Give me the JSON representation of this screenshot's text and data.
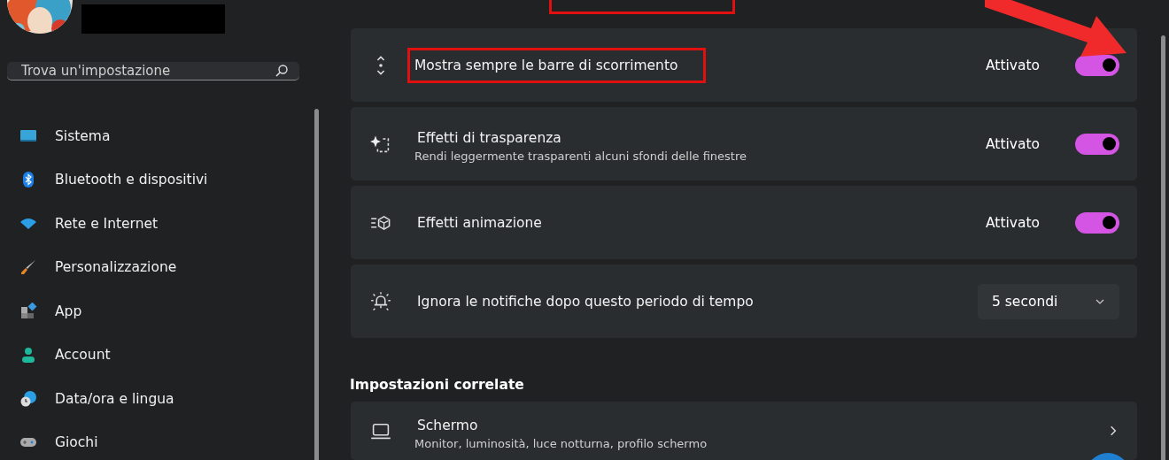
{
  "sidebar": {
    "search": {
      "placeholder": "Trova un'impostazione"
    },
    "items": [
      {
        "label": "Sistema",
        "selected": false
      },
      {
        "label": "Bluetooth e dispositivi",
        "selected": false
      },
      {
        "label": "Rete e Internet",
        "selected": false
      },
      {
        "label": "Personalizzazione",
        "selected": false
      },
      {
        "label": "App",
        "selected": false
      },
      {
        "label": "Account",
        "selected": false
      },
      {
        "label": "Data/ora e lingua",
        "selected": false
      },
      {
        "label": "Giochi",
        "selected": false
      }
    ]
  },
  "settings": [
    {
      "kind": "toggle",
      "title": "Mostra sempre le barre di scorrimento",
      "highlighted": true,
      "state_label": "Attivato",
      "on": true
    },
    {
      "kind": "toggle",
      "title": "Effetti di trasparenza",
      "description": "Rendi leggermente trasparenti alcuni sfondi delle finestre",
      "highlighted": false,
      "state_label": "Attivato",
      "on": true
    },
    {
      "kind": "toggle",
      "title": "Effetti animazione",
      "highlighted": false,
      "state_label": "Attivato",
      "on": true
    },
    {
      "kind": "dropdown",
      "title": "Ignora le notifiche dopo questo periodo di tempo",
      "highlighted": false,
      "value": "5 secondi"
    }
  ],
  "related": {
    "heading": "Impostazioni correlate",
    "items": [
      {
        "title": "Schermo",
        "description": "Monitor, luminosità, luce notturna, profilo schermo"
      }
    ]
  },
  "annotations": {
    "top_box": true,
    "arrow": true
  }
}
